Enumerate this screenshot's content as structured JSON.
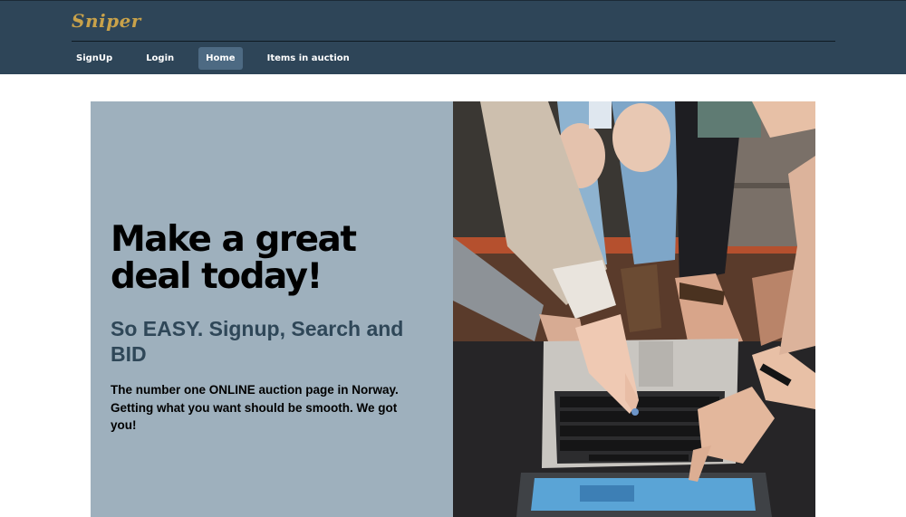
{
  "brand": {
    "name": "Sniper"
  },
  "nav": {
    "items": [
      {
        "label": "SignUp"
      },
      {
        "label": "Login"
      },
      {
        "label": "Home"
      },
      {
        "label": "Items in auction"
      }
    ],
    "active": "Home"
  },
  "hero": {
    "title": "Make a great deal today!",
    "subtitle": "So EASY. Signup, Search and BID",
    "description": "The number one ONLINE auction page in Norway. Getting what you want should be smooth. We got you!",
    "image_description": "people-pointing-at-laptop-photo"
  },
  "colors": {
    "header_bg": "#2e4558",
    "brand": "#c9a24a",
    "nav_active_bg": "#4d6a83",
    "hero_panel_bg": "#9eb0bd",
    "subtitle": "#2f4758"
  }
}
